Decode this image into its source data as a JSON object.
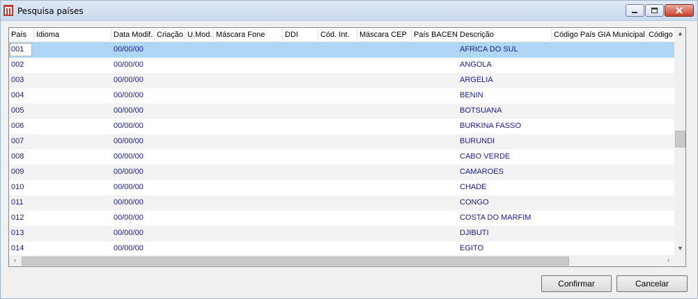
{
  "window": {
    "title": "Pesquisa países"
  },
  "grid": {
    "columns": [
      "País",
      "Idioma",
      "Data Modif.",
      "Criação",
      "U.Mod.",
      "Máscara Fone",
      "DDI",
      "Cód. Int.",
      "Máscara CEP",
      "País BACEN",
      "Descrição",
      "Código País GIA Municipal",
      "Código"
    ],
    "rows": [
      {
        "pais": "001",
        "data_modif": "00/00/00",
        "descricao": "AFRICA DO SUL"
      },
      {
        "pais": "002",
        "data_modif": "00/00/00",
        "descricao": "ANGOLA"
      },
      {
        "pais": "003",
        "data_modif": "00/00/00",
        "descricao": "ARGELIA"
      },
      {
        "pais": "004",
        "data_modif": "00/00/00",
        "descricao": "BENIN"
      },
      {
        "pais": "005",
        "data_modif": "00/00/00",
        "descricao": "BOTSUANA"
      },
      {
        "pais": "006",
        "data_modif": "00/00/00",
        "descricao": "BURKINA FASSO"
      },
      {
        "pais": "007",
        "data_modif": "00/00/00",
        "descricao": "BURUNDI"
      },
      {
        "pais": "008",
        "data_modif": "00/00/00",
        "descricao": "CABO VERDE"
      },
      {
        "pais": "009",
        "data_modif": "00/00/00",
        "descricao": "CAMAROES"
      },
      {
        "pais": "010",
        "data_modif": "00/00/00",
        "descricao": "CHADE"
      },
      {
        "pais": "011",
        "data_modif": "00/00/00",
        "descricao": "CONGO"
      },
      {
        "pais": "012",
        "data_modif": "00/00/00",
        "descricao": "COSTA DO MARFIM"
      },
      {
        "pais": "013",
        "data_modif": "00/00/00",
        "descricao": "DJIBUTI"
      },
      {
        "pais": "014",
        "data_modif": "00/00/00",
        "descricao": "EGITO"
      }
    ],
    "selected_row": 0
  },
  "buttons": {
    "confirm": "Confirmar",
    "cancel": "Cancelar"
  },
  "colors": {
    "selection": "#aed6f5",
    "cell_text": "#1a1a8c",
    "alt_row": "#f3f3f3"
  }
}
